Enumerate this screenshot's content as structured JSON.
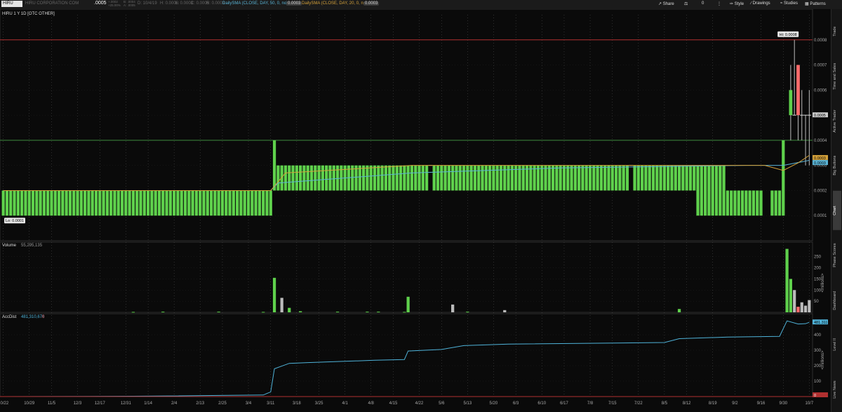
{
  "topbar": {
    "symbol": "HIRU",
    "company": "HIRU CORPORATION COM",
    "last": ".0005",
    "change": "+.0002",
    "change_pct": "+25.00%",
    "bid": "B: .0004",
    "ask": "A: .0005",
    "ohlc": {
      "date": "D: 10/4/19",
      "high": "H: 0.0006",
      "low": "L: 0.0003",
      "close": "C: 0.0005",
      "range": "R: 0.0003"
    },
    "study1": "DailySMA (CLOSE, DAY, 50, 0, no)",
    "study1_value": "0.0003",
    "study2": "DailySMA (CLOSE, DAY, 20, 0, no)",
    "study2_value": "0.0003",
    "share": "Share",
    "count": "0",
    "style": "Style",
    "drawings": "Drawings",
    "studies": "Studies",
    "patterns": "Patterns"
  },
  "sidebar": {
    "tabs": [
      "Trade",
      "Time and Sales",
      "Active Trader",
      "Big Buttons",
      "Chart",
      "Phase Scores",
      "Dashboard",
      "Level II",
      "Live News"
    ],
    "active": "Chart"
  },
  "price_pane": {
    "title": "HIRU 1 Y 1D [OTC OTHER]",
    "hi_label": "Hi: 0.0008",
    "lo_label": "Lo: 0.0001",
    "y_ticks": [
      "0.0008",
      "0.0007",
      "0.0006",
      "0.0005",
      "0.0004",
      "0.0003",
      "0.0002",
      "0.0001"
    ],
    "last_badge": "0.0005",
    "sma_badges": [
      "0.0003",
      "0.0003"
    ]
  },
  "volume_pane": {
    "title": "Volume",
    "value": "55,295,135",
    "y_ticks": [
      "250",
      "200",
      "150",
      "100",
      "50"
    ],
    "unit": "<millions>"
  },
  "accdist_pane": {
    "title": "AccDist",
    "value": "481,310,676",
    "flag": "0",
    "y_ticks": [
      "400",
      "300",
      "200",
      "100"
    ],
    "badge": "481.311",
    "zero_badge": "0",
    "unit": "<millions>"
  },
  "x_axis": {
    "labels": [
      "10/22",
      "10/29",
      "11/5",
      "12/3",
      "12/17",
      "12/31",
      "1/14",
      "2/4",
      "2/13",
      "2/25",
      "3/4",
      "3/11",
      "3/18",
      "3/25",
      "4/1",
      "4/8",
      "4/15",
      "4/22",
      "5/6",
      "5/13",
      "5/20",
      "6/3",
      "6/10",
      "6/17",
      "7/8",
      "7/15",
      "7/22",
      "8/5",
      "8/12",
      "8/19",
      "9/2",
      "9/16",
      "9/30",
      "10/7"
    ]
  },
  "colors": {
    "up": "#5fd14c",
    "down": "#ff6b6b",
    "neutral_volume": "#bbbbbb",
    "sma50": "#5ab4d6",
    "sma20": "#d4a13a",
    "accdist": "#4fb3d9",
    "hi_line": "#b03030",
    "level_line": "#3e8a3e",
    "grid": "#555555"
  },
  "chart_data": {
    "type": "candlestick",
    "x_unit": "trading day",
    "price": {
      "ylim": [
        0,
        0.0009
      ],
      "hi": 0.0008,
      "lo": 0.0001,
      "segments": [
        {
          "from": 0,
          "to": 72,
          "open": 0.0002,
          "close": 0.0001,
          "dir": "up"
        },
        {
          "from": 73,
          "to": 73,
          "open": 0.0002,
          "close": 0.0004,
          "dir": "up"
        },
        {
          "from": 74,
          "to": 114,
          "open": 0.0002,
          "close": 0.0003,
          "dir": "up"
        },
        {
          "from": 115,
          "to": 115,
          "open": 0.0003,
          "close": 0.0003,
          "dir": "doji"
        },
        {
          "from": 116,
          "to": 168,
          "open": 0.0002,
          "close": 0.0003,
          "dir": "up"
        },
        {
          "from": 169,
          "to": 169,
          "open": 0.0003,
          "close": 0.0003,
          "dir": "doji"
        },
        {
          "from": 170,
          "to": 186,
          "open": 0.0002,
          "close": 0.0003,
          "dir": "up"
        },
        {
          "from": 187,
          "to": 194,
          "open": 0.0001,
          "close": 0.0003,
          "dir": "up"
        },
        {
          "from": 195,
          "to": 199,
          "open": 0.0001,
          "close": 0.0002,
          "dir": "up"
        },
        {
          "from": 200,
          "to": 204,
          "open": 0.0001,
          "close": 0.0002,
          "dir": "up"
        },
        {
          "from": 207,
          "to": 209,
          "open": 0.0001,
          "close": 0.0002,
          "dir": "up"
        },
        {
          "from": 210,
          "to": 210,
          "open": 0.0001,
          "close": 0.0004,
          "dir": "up"
        }
      ],
      "recent": [
        {
          "i": 212,
          "open": 0.0005,
          "close": 0.0006,
          "high": 0.0007,
          "low": 0.0004,
          "dir": "up"
        },
        {
          "i": 213,
          "open": 0.0005,
          "close": 0.0005,
          "high": 0.0008,
          "low": 0.0005,
          "dir": "doji"
        },
        {
          "i": 214,
          "open": 0.0007,
          "close": 0.0005,
          "high": 0.0007,
          "low": 0.0004,
          "dir": "down"
        },
        {
          "i": 215,
          "open": 0.0005,
          "close": 0.0005,
          "high": 0.0006,
          "low": 0.0004,
          "dir": "doji"
        },
        {
          "i": 216,
          "open": 0.0005,
          "close": 0.0005,
          "high": 0.0005,
          "low": 0.0003,
          "dir": "doji"
        },
        {
          "i": 217,
          "open": 0.0005,
          "close": 0.0005,
          "high": 0.0006,
          "low": 0.0003,
          "dir": "doji"
        }
      ],
      "sma50": [
        [
          0,
          0.0002
        ],
        [
          72,
          0.0002
        ],
        [
          74,
          0.00023
        ],
        [
          110,
          0.00027
        ],
        [
          150,
          0.00029
        ],
        [
          200,
          0.0003
        ],
        [
          210,
          0.0003
        ],
        [
          217,
          0.00032
        ]
      ],
      "sma20": [
        [
          0,
          0.0002
        ],
        [
          72,
          0.0002
        ],
        [
          76,
          0.00027
        ],
        [
          110,
          0.0003
        ],
        [
          205,
          0.0003
        ],
        [
          210,
          0.00028
        ],
        [
          214,
          0.00031
        ],
        [
          217,
          0.00034
        ]
      ]
    },
    "volume": {
      "ylim": [
        0,
        290
      ],
      "bars": [
        [
          35,
          2,
          "up"
        ],
        [
          43,
          3,
          "up"
        ],
        [
          58,
          3,
          "up"
        ],
        [
          70,
          2,
          "up"
        ],
        [
          73,
          155,
          "up"
        ],
        [
          75,
          65,
          "neutral"
        ],
        [
          77,
          20,
          "up"
        ],
        [
          80,
          5,
          "up"
        ],
        [
          90,
          3,
          "up"
        ],
        [
          98,
          3,
          "up"
        ],
        [
          101,
          3,
          "up"
        ],
        [
          108,
          2,
          "up"
        ],
        [
          109,
          70,
          "up"
        ],
        [
          121,
          35,
          "neutral"
        ],
        [
          125,
          3,
          "up"
        ],
        [
          135,
          10,
          "neutral"
        ],
        [
          182,
          15,
          "up"
        ],
        [
          211,
          285,
          "up"
        ],
        [
          212,
          150,
          "up"
        ],
        [
          213,
          100,
          "neutral"
        ],
        [
          214,
          25,
          "down"
        ],
        [
          215,
          45,
          "neutral"
        ],
        [
          216,
          30,
          "neutral"
        ],
        [
          217,
          55,
          "neutral"
        ]
      ]
    },
    "accdist": {
      "ylim": [
        0,
        500
      ],
      "points": [
        [
          0,
          0
        ],
        [
          35,
          2
        ],
        [
          70,
          10
        ],
        [
          72,
          30
        ],
        [
          73,
          180
        ],
        [
          77,
          215
        ],
        [
          82,
          220
        ],
        [
          100,
          235
        ],
        [
          108,
          240
        ],
        [
          109,
          295
        ],
        [
          118,
          305
        ],
        [
          124,
          330
        ],
        [
          136,
          340
        ],
        [
          178,
          350
        ],
        [
          182,
          375
        ],
        [
          195,
          385
        ],
        [
          209,
          390
        ],
        [
          211,
          490
        ],
        [
          214,
          470
        ],
        [
          216,
          472
        ],
        [
          217,
          481
        ]
      ]
    }
  }
}
